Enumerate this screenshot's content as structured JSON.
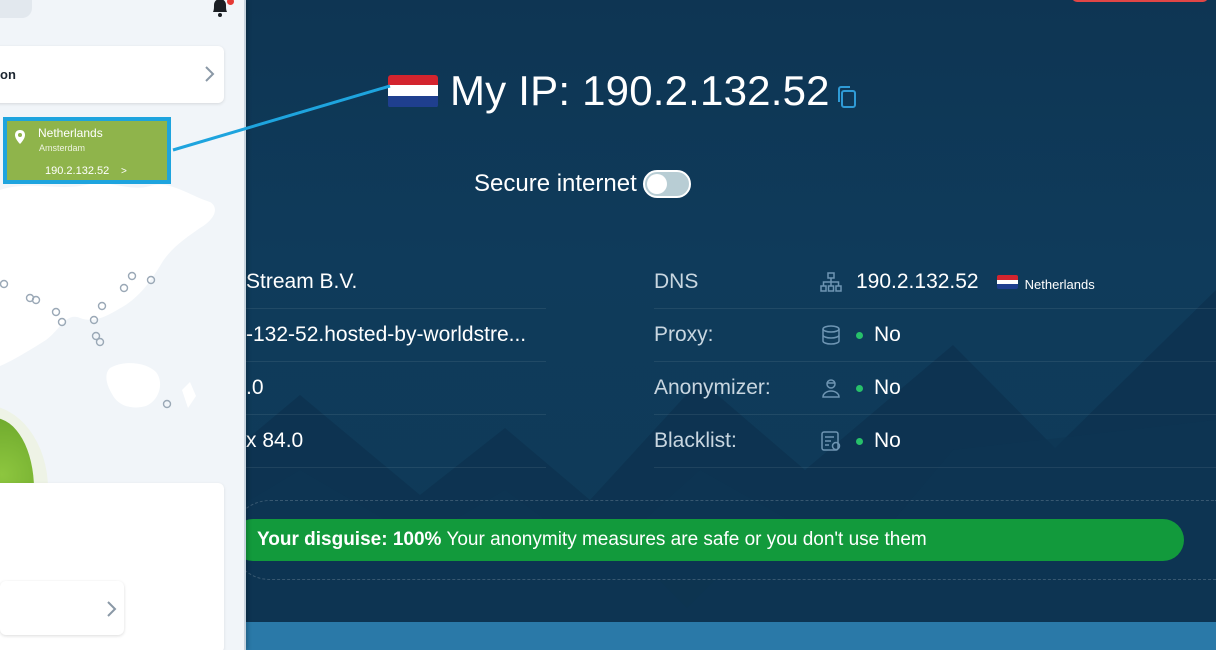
{
  "ip_heading": {
    "title": "My IP: 190.2.132.52",
    "copy_icon": "copy-icon",
    "flag": "netherlands-flag"
  },
  "secure_internet": {
    "label": "Secure internet",
    "enabled": false
  },
  "left_rows": [
    "Stream B.V.",
    "-132-52.hosted-by-worldstre...",
    ".0",
    "x 84.0"
  ],
  "right_rows": {
    "dns": {
      "label": "DNS",
      "icon": "network-icon",
      "value": "190.2.132.52",
      "country": "Netherlands"
    },
    "proxy": {
      "label": "Proxy:",
      "icon": "database-icon",
      "value": "No"
    },
    "anonymizer": {
      "label": "Anonymizer:",
      "icon": "user-icon",
      "value": "No"
    },
    "blacklist": {
      "label": "Blacklist:",
      "icon": "list-check-icon",
      "value": "No"
    }
  },
  "disguise": {
    "bold": "Your disguise: 100%",
    "text": "Your anonymity measures are safe or you don't use them"
  },
  "panel": {
    "top_card_label": "on",
    "location_popup": {
      "country": "Netherlands",
      "city": "Amsterdam",
      "ip": "190.2.132.52",
      "arrow": ">"
    }
  },
  "colors": {
    "background": "#0f3a57",
    "disguise_green": "#129a3c",
    "popup_green": "#8fb44b",
    "popup_border": "#1ea4de",
    "status_dot": "#27c06a"
  }
}
